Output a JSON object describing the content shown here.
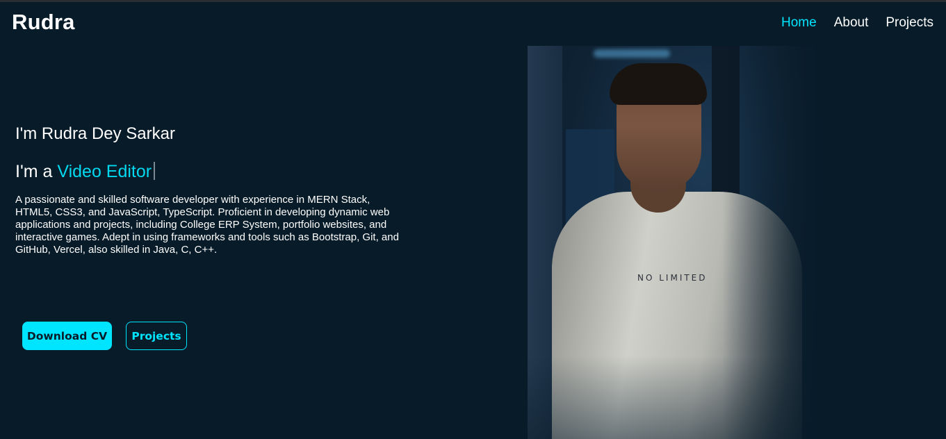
{
  "header": {
    "logo": "Rudra",
    "nav": [
      {
        "label": "Home",
        "active": true
      },
      {
        "label": "About",
        "active": false
      },
      {
        "label": "Projects",
        "active": false
      }
    ]
  },
  "hero": {
    "name_line": "I'm Rudra Dey Sarkar",
    "role_prefix": "I'm a",
    "role_word": "Video Editor",
    "bio": "A passionate and skilled software developer with experience in MERN Stack, HTML5, CSS3, and JavaScript, TypeScript. Proficient in developing dynamic web applications and projects, including College ERP System, portfolio websites, and interactive games. Adept in using frameworks and tools such as Bootstrap, Git, and GitHub, Vercel, also skilled in Java, C, C++.",
    "buttons": {
      "download_cv": "Download CV",
      "projects": "Projects"
    }
  },
  "photo": {
    "shirt_text": "NO LIMITED"
  },
  "colors": {
    "background": "#081b29",
    "accent": "#00e5ff",
    "text": "#ffffff"
  }
}
